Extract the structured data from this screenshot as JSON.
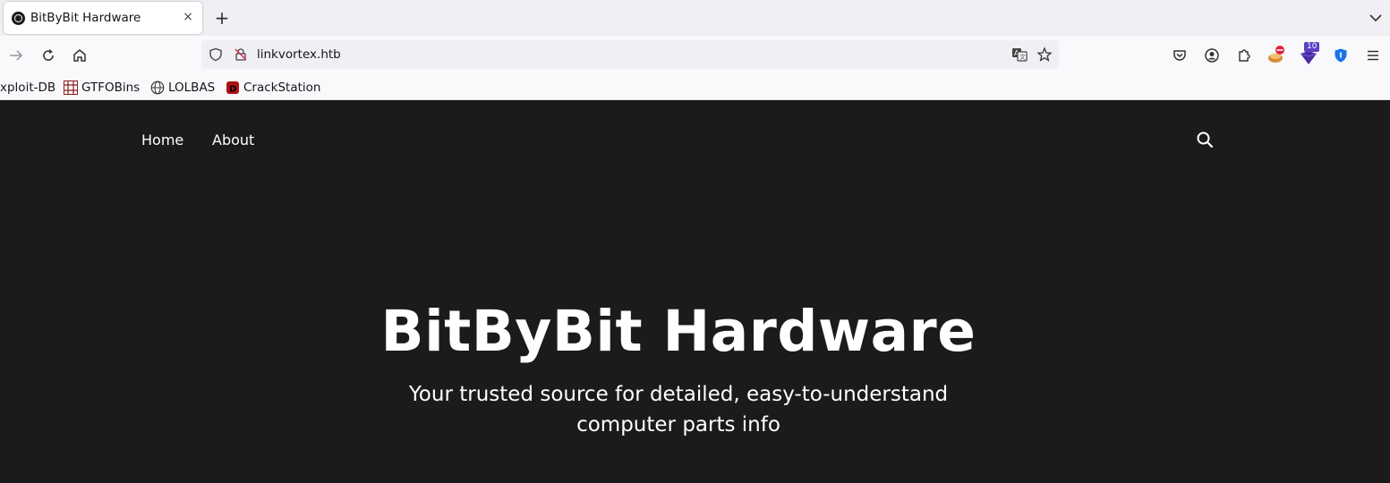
{
  "browser": {
    "tab": {
      "title": "BitByBit Hardware",
      "close": "×"
    },
    "new_tab": "+",
    "url": "linkvortex.htb",
    "extension_badge": "10",
    "bookmarks": [
      {
        "label": "xploit-DB"
      },
      {
        "label": "GTFOBins"
      },
      {
        "label": "LOLBAS"
      },
      {
        "label": "CrackStation"
      }
    ]
  },
  "site": {
    "nav": [
      {
        "label": "Home"
      },
      {
        "label": "About"
      }
    ],
    "hero": {
      "title": "BitByBit Hardware",
      "subtitle": "Your trusted source for detailed, easy-to-understand computer parts info"
    },
    "colors": {
      "background": "#1c1a1b",
      "text": "#ffffff"
    }
  }
}
